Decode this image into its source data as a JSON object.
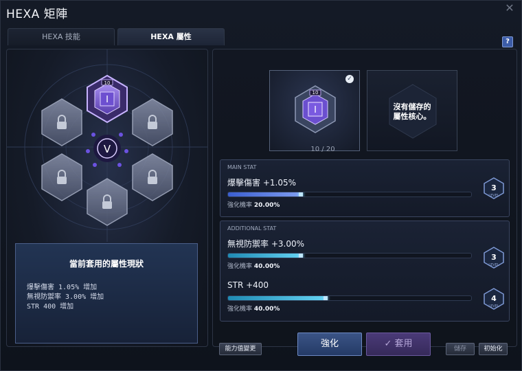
{
  "window": {
    "title": "HEXA 矩陣",
    "close": "✕",
    "help": "?"
  },
  "tabs": [
    {
      "label": "HEXA 技能",
      "active": false
    },
    {
      "label": "HEXA 屬性",
      "active": true
    }
  ],
  "hex_grid": {
    "top_core_level": "10",
    "center_icon": "hexa-core-center-icon",
    "locked_slots": 5
  },
  "status": {
    "title": "當前套用的屬性現狀",
    "lines": [
      "爆擊傷害 1.05% 增加",
      "無視防禦率 3.00% 增加",
      "STR 400 增加"
    ]
  },
  "equipped_core": {
    "badge": "10",
    "progress": "10 / 20"
  },
  "empty_core": {
    "text_line1": "沒有儲存的",
    "text_line2": "屬性核心。"
  },
  "main_stat": {
    "section_label": "MAIN STAT",
    "name": "爆擊傷害 +1.05%",
    "prob_label": "強化機率",
    "prob_value": "20.00%",
    "level": "3",
    "level_word": "LEVEL",
    "fill": 0.3
  },
  "additional_stat": {
    "section_label": "ADDITIONAL STAT",
    "stats": [
      {
        "name": "無視防禦率 +3.00%",
        "prob_label": "強化機率",
        "prob_value": "40.00%",
        "level": "3",
        "level_word": "LEVEL",
        "fill": 0.3
      },
      {
        "name": "STR +400",
        "prob_label": "強化機率",
        "prob_value": "40.00%",
        "level": "4",
        "level_word": "LEVEL",
        "fill": 0.4
      }
    ]
  },
  "buttons": {
    "ability_change": "能力值變更",
    "enhance": "強化",
    "apply": "套用",
    "save": "儲存",
    "reset": "初始化"
  },
  "colors": {
    "accent": "#6e8ac4",
    "purple": "#8a6ad6",
    "bar_main": "#5f7fe6",
    "bar_cyan": "#49c0e8"
  }
}
